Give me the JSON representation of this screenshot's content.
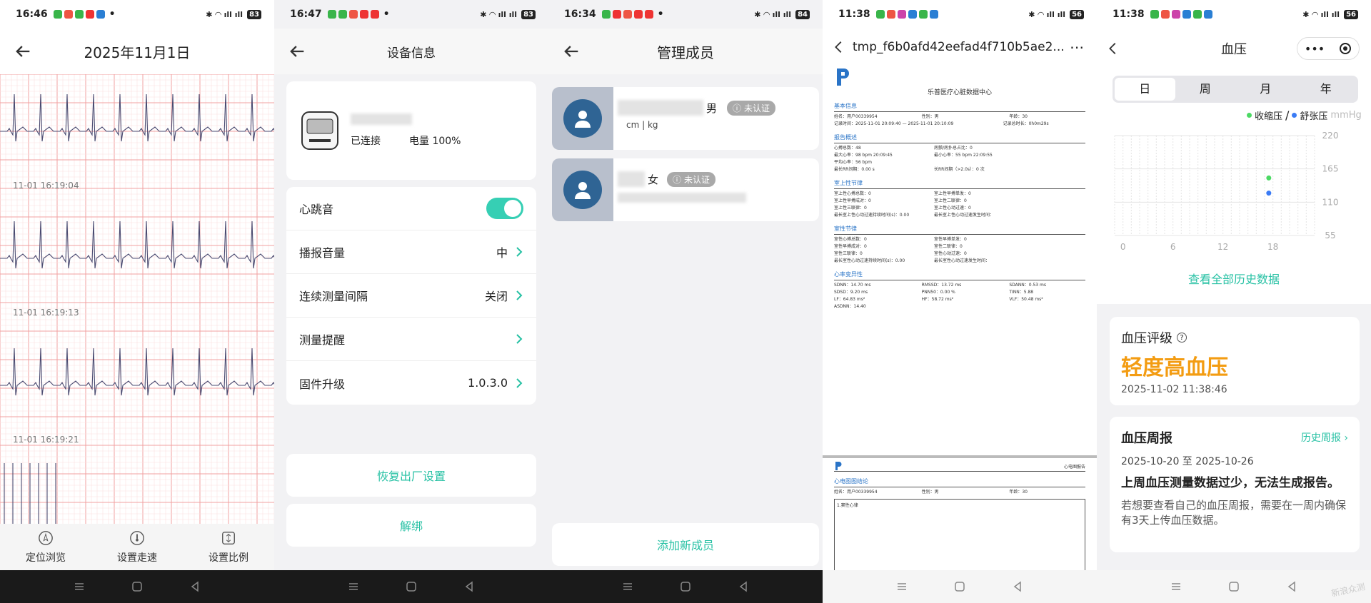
{
  "panels": {
    "p1": {
      "time": "16:46",
      "battery": "83",
      "title": "2025年11月1日",
      "timestamps": [
        "11-01 16:19:04",
        "11-01 16:19:13",
        "11-01 16:19:21"
      ],
      "bottom_buttons": [
        "定位浏览",
        "设置走速",
        "设置比例"
      ]
    },
    "p2": {
      "time": "16:47",
      "battery": "83",
      "title": "设备信息",
      "device": {
        "status": "已连接",
        "battery": "电量 100%"
      },
      "rows": [
        {
          "label": "心跳音",
          "value": ""
        },
        {
          "label": "播报音量",
          "value": "中"
        },
        {
          "label": "连续测量间隔",
          "value": "关闭"
        },
        {
          "label": "测量提醒",
          "value": ""
        },
        {
          "label": "固件升级",
          "value": "1.0.3.0"
        }
      ],
      "reset": "恢复出厂设置",
      "unbind": "解绑"
    },
    "p3": {
      "time": "16:34",
      "battery": "84",
      "title": "管理成员",
      "members": [
        {
          "gender": "男",
          "badge": "未认证",
          "units": "cm  |  kg"
        },
        {
          "gender": "女",
          "badge": "未认证",
          "units": ""
        }
      ],
      "add": "添加新成员"
    },
    "p4": {
      "time": "11:38",
      "battery": "56",
      "title": "tmp_f6b0afd42eefad4f710b5ae2...",
      "report_title": "乐普医疗心脏数据中心",
      "sections": [
        "基本信息",
        "报告概述",
        "室上性节律",
        "室性节律",
        "心率变异性"
      ],
      "basic": [
        "姓名：用户00339954",
        "性别：男",
        "年龄：30",
        "记录时间：2025-11-01 20:09:40  —  2025-11-01 20:10:09",
        "记录总时长：0h0m29s"
      ],
      "summary": [
        "心搏总数：48",
        "房颤/房扑总占比：0",
        "最大心率：98 bpm 20:09:45",
        "最小心率：55 bpm 22:09:55",
        "平均心率：56 bpm",
        "最长RR间期：0.00 s",
        "长RR间期（>2.0s）：0 次"
      ],
      "sv": [
        "室上性心搏总数：0",
        "室上性早搏单发：0",
        "室上性早搏成对：0",
        "室上性二联律：0",
        "室上性三联律：0",
        "室上性心动过速：0",
        "最长室上性心动过速持续时间(s)：0.00",
        "最长室上性心动过速发生时间："
      ],
      "v": [
        "室性心搏总数：0",
        "室性早搏单发：0",
        "室性早搏成对：0",
        "室性二联律：0",
        "室性三联律：0",
        "室性心动过速：0",
        "最长室性心动过速持续时间(s)：0.00",
        "最长室性心动过速发生时间："
      ],
      "hrv": [
        "SDNN：14.70 ms",
        "RMSSD：13.72 ms",
        "SDANN：0.53 ms",
        "SDSD：9.20 ms",
        "PNN50：0.00 %",
        "TINN：5.88",
        "LF：64.83 ms²",
        "HF：58.72 ms²",
        "VLF：50.48 ms²",
        "ASDNN：14.40"
      ],
      "page2_header": "心电图报告",
      "page2_section": "心电图图结论",
      "page2_info": [
        "姓名：用户00339954",
        "性别：男",
        "年龄：30"
      ],
      "page2_conclusion": "1.窦性心律"
    },
    "p5": {
      "time": "11:38",
      "battery": "56",
      "title": "血压",
      "tabs": [
        "日",
        "周",
        "月",
        "年"
      ],
      "legend": [
        "收缩压",
        "舒张压"
      ],
      "unit": "mmHg",
      "view_all": "查看全部历史数据",
      "rating_title": "血压评级",
      "rating_value": "轻度高血压",
      "rating_time": "2025-11-02 11:38:46",
      "weekly_title": "血压周报",
      "weekly_link": "历史周报",
      "weekly_range": "2025-10-20 至 2025-10-26",
      "weekly_headline": "上周血压测量数据过少，无法生成报告。",
      "weekly_note": "若想要查看自己的血压周报，需要在一周内确保有3天上传血压数据。",
      "watermark": "新浪众测"
    }
  },
  "chart_data": {
    "type": "scatter",
    "x_ticks": [
      "0",
      "6",
      "12",
      "18"
    ],
    "y_ticks": [
      "220",
      "165",
      "110",
      "55"
    ],
    "ylim": [
      55,
      220
    ],
    "xlim": [
      0,
      24
    ],
    "series": [
      {
        "name": "收缩压",
        "color": "#4cd964",
        "points": [
          [
            18,
            150
          ]
        ]
      },
      {
        "name": "舒张压",
        "color": "#3a7bf5",
        "points": [
          [
            18,
            125
          ]
        ]
      }
    ]
  }
}
